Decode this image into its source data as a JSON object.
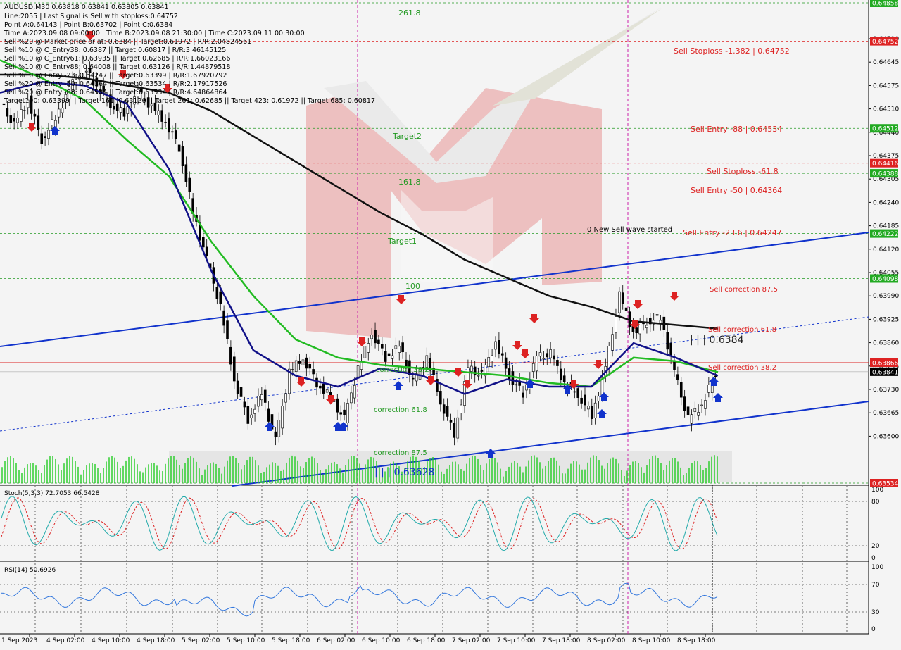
{
  "window": {
    "symbol_line": "AUDUSD,M30  0.63818 0.63841 0.63805 0.63841"
  },
  "info_lines": [
    "Line:2055 | Last Signal is:Sell with stoploss:0.64752",
    "Point A:0.64143 | Point B:0.63702 | Point C:0.6384",
    "Time A:2023.09.08 09:00:00 | Time B:2023.09.08 21:30:00 | Time C:2023.09.11 00:30:00",
    "Sell %20 @ Market price or at: 0.6384 || Target:0.61972 | R/R:2.04824561",
    "Sell %10 @ C_Entry38: 0.6387 || Target:0.60817 | R/R:3.46145125",
    "Sell %10 @ C_Entry61: 0.63935 || Target:0.62685 | R/R:1.66023166",
    "Sell %10 @ C_Entry88: 0.64008 || Target:0.63126 | R/R:1.44879518",
    "Sell %10 @ Entry -23: 0.64247 || Target:0.63399 | R/R:1.67920792",
    "Sell %20 @ Entry -50: 0.64364 || Target:0.63534 | R/R:2.17917526",
    "Sell %20 @ Entry -88: 0.64534 || Target:0.63534 | R/R:4.64864864",
    "Target100: 0.63399 || Target 161: 0.63126 || Target 261: 0.62685 || Target 423: 0.61972 || Target 685: 0.60817"
  ],
  "chart_data": [
    {
      "type": "line",
      "panel": "price",
      "title": "AUDUSD,M30",
      "ylim": [
        0.63534,
        0.64858
      ],
      "price_ticks": [
        "0.64710",
        "0.64645",
        "0.64575",
        "0.64510",
        "0.64440",
        "0.64375",
        "0.64305",
        "0.64240",
        "0.64185",
        "0.64120",
        "0.64055",
        "0.63990",
        "0.63925",
        "0.63860",
        "0.63795",
        "0.63730",
        "0.63665",
        "0.63600"
      ],
      "x_labels": [
        "1 Sep 2023",
        "4 Sep 02:00",
        "4 Sep 10:00",
        "4 Sep 18:00",
        "5 Sep 02:00",
        "5 Sep 10:00",
        "5 Sep 18:00",
        "6 Sep 02:00",
        "6 Sep 10:00",
        "6 Sep 18:00",
        "7 Sep 02:00",
        "7 Sep 10:00",
        "7 Sep 18:00",
        "8 Sep 02:00",
        "8 Sep 10:00",
        "8 Sep 18:00"
      ],
      "close_series": [
        0.6458,
        0.6452,
        0.6459,
        0.6448,
        0.6454,
        0.6462,
        0.6468,
        0.6463,
        0.6458,
        0.6455,
        0.6461,
        0.6457,
        0.6453,
        0.6446,
        0.6428,
        0.6415,
        0.6402,
        0.6382,
        0.6371,
        0.6378,
        0.6365,
        0.6384,
        0.6388,
        0.6381,
        0.6377,
        0.6371,
        0.6385,
        0.6395,
        0.6388,
        0.6391,
        0.6381,
        0.6388,
        0.6376,
        0.6367,
        0.6385,
        0.6383,
        0.6392,
        0.6383,
        0.6378,
        0.6388,
        0.6389,
        0.6381,
        0.6378,
        0.6372,
        0.6385,
        0.6405,
        0.6395,
        0.6398,
        0.6399,
        0.6384,
        0.6371,
        0.6375,
        0.6384
      ],
      "ma_black": [
        0.6466,
        0.6466,
        0.6465,
        0.6463,
        0.6461,
        0.6456,
        0.6449,
        0.6442,
        0.6435,
        0.6428,
        0.6422,
        0.6415,
        0.641,
        0.6405,
        0.6402,
        0.6398,
        0.6397,
        0.6396
      ],
      "ma_green": [
        0.647,
        0.6465,
        0.6459,
        0.6448,
        0.6438,
        0.642,
        0.6405,
        0.6393,
        0.6388,
        0.6386,
        0.6385,
        0.6384,
        0.6383,
        0.6381,
        0.638,
        0.6388,
        0.6387,
        0.6384
      ],
      "ma_navy": [
        0.6461,
        0.6464,
        0.6463,
        0.6458,
        0.644,
        0.6412,
        0.639,
        0.6383,
        0.638,
        0.6385,
        0.6383,
        0.6378,
        0.6382,
        0.638,
        0.638,
        0.6392,
        0.6388,
        0.6383
      ],
      "levels": [
        {
          "label": "Sell Stoploss -1.382 | 0.64752",
          "price": "0.64752",
          "y": 0.64752,
          "color": "#d22"
        },
        {
          "label": "Sell Entry -88 | 0.64534",
          "price": "0.64512",
          "y": 0.64512,
          "color": "#d22"
        },
        {
          "label": "Sell Stoploss -61.8",
          "price": "0.64416",
          "y": 0.64416,
          "color": "#d22"
        },
        {
          "label": "Sell Entry -50 | 0.64364",
          "price": "0.64388",
          "y": 0.64388,
          "color": "#d22"
        },
        {
          "label": "Sell Entry -23.6 | 0.64247",
          "price": "0.64222",
          "y": 0.64222,
          "color": "#d22"
        },
        {
          "label": "Sell correction 87.5",
          "price": "0.64098",
          "y": 0.64098,
          "color": "#d22"
        },
        {
          "label": "Sell correction 61.8",
          "price": "",
          "y": 0.63955,
          "color": "#d22"
        },
        {
          "label": "Sell correction 38.2",
          "price": "0.63866",
          "y": 0.63866,
          "color": "#d22"
        }
      ],
      "fib_labels": [
        "261.8",
        "Target2",
        "161.8",
        "Target1",
        "100",
        "correction 38.2",
        "correction 61.8",
        "correction 87.5"
      ],
      "annotations": {
        "wave_text": "0 New Sell wave started",
        "point_c": "| | | 0.6384",
        "point_b": "| | | 0.63628"
      },
      "price_tags": {
        "top": "0.64858",
        "stoploss": "0.64752",
        "entry88": "0.64512",
        "stoploss618": "0.64416",
        "entry50": "0.64388",
        "entry236": "0.64222",
        "corr875": "0.64098",
        "corr382": "0.63866",
        "current": "0.63841",
        "bottom": "0.63534"
      }
    },
    {
      "type": "line",
      "panel": "stochastic",
      "title": "Stoch(5,3,3) 72.7053 66.5428",
      "ylim": [
        0,
        100
      ],
      "ticks": [
        "100",
        "80",
        "20",
        "0"
      ]
    },
    {
      "type": "line",
      "panel": "rsi",
      "title": "RSI(14) 50.6926",
      "ylim": [
        0,
        100
      ],
      "ticks": [
        "100",
        "70",
        "30",
        "0"
      ]
    }
  ],
  "colors": {
    "bg": "#f4f4f4",
    "candle": "#000000",
    "ma_black": "#111111",
    "ma_green": "#22bb22",
    "ma_navy": "#111188",
    "channel": "#1133cc",
    "level_red": "#dd2222",
    "level_green": "#229922",
    "tag_red": "#dd2222",
    "tag_green": "#22aa22",
    "stoch_main": "#22aaaa",
    "stoch_signal": "#dd2222",
    "rsi": "#3377dd"
  }
}
